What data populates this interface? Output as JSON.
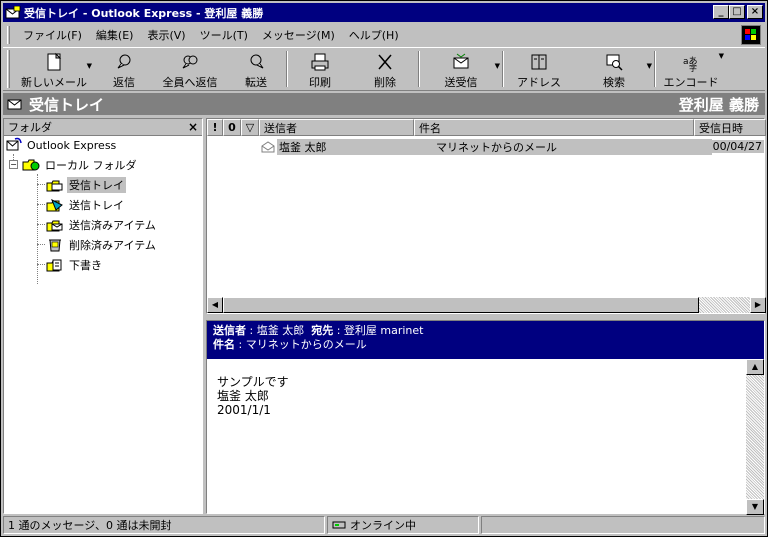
{
  "window": {
    "title": "受信トレイ - Outlook Express - 登利屋 義勝",
    "minimize_glyph": "_",
    "maximize_glyph": "□",
    "close_glyph": "×"
  },
  "menu": {
    "items": [
      {
        "label": "ファイル(F)"
      },
      {
        "label": "編集(E)"
      },
      {
        "label": "表示(V)"
      },
      {
        "label": "ツール(T)"
      },
      {
        "label": "メッセージ(M)"
      },
      {
        "label": "ヘルプ(H)"
      }
    ]
  },
  "toolbar": {
    "new_mail": "新しいメール",
    "reply": "返信",
    "reply_all": "全員へ返信",
    "forward": "転送",
    "print": "印刷",
    "delete": "削除",
    "send_receive": "送受信",
    "addresses": "アドレス",
    "find": "検索",
    "encode": "エンコード",
    "drop_glyph": "▼"
  },
  "folder_bar": {
    "folder_name": "受信トレイ",
    "user_name": "登利屋  義勝"
  },
  "folder_pane": {
    "header": "フォルダ",
    "close_glyph": "×",
    "root": "Outlook Express",
    "local_folders": "ローカル フォルダ",
    "expand_glyph": "−",
    "folders": [
      {
        "label": "受信トレイ",
        "icon": "inbox-icon",
        "selected": true
      },
      {
        "label": "送信トレイ",
        "icon": "outbox-icon",
        "selected": false
      },
      {
        "label": "送信済みアイテム",
        "icon": "sent-items-icon",
        "selected": false
      },
      {
        "label": "削除済みアイテム",
        "icon": "deleted-items-icon",
        "selected": false
      },
      {
        "label": "下書き",
        "icon": "drafts-icon",
        "selected": false
      }
    ]
  },
  "message_list": {
    "columns": {
      "priority": "!",
      "attachment": "0",
      "flag": "▽",
      "from": "送信者",
      "subject": "件名",
      "received": "受信日時"
    },
    "rows": [
      {
        "from": "塩釜  太郎",
        "subject": "マリネットからのメール",
        "received": "00/04/27"
      }
    ],
    "scroll_left": "◀",
    "scroll_right": "▶"
  },
  "preview": {
    "from_label": "送信者",
    "from_value": ": 塩釜  太郎",
    "to_label": "宛先",
    "to_value": ": 登利屋 marinet",
    "subject_label": "件名",
    "subject_value": ": マリネットからのメール",
    "body": [
      "サンプルです",
      "塩釜  太郎",
      "2001/1/1"
    ],
    "scroll_up": "▲",
    "scroll_down": "▼"
  },
  "status": {
    "message_count": "1 通のメッセージ、0 通は未開封",
    "connection": "オンライン中"
  },
  "colors": {
    "title_bar": "#000080",
    "face": "#c0c0c0",
    "folder_bar": "#808080"
  }
}
